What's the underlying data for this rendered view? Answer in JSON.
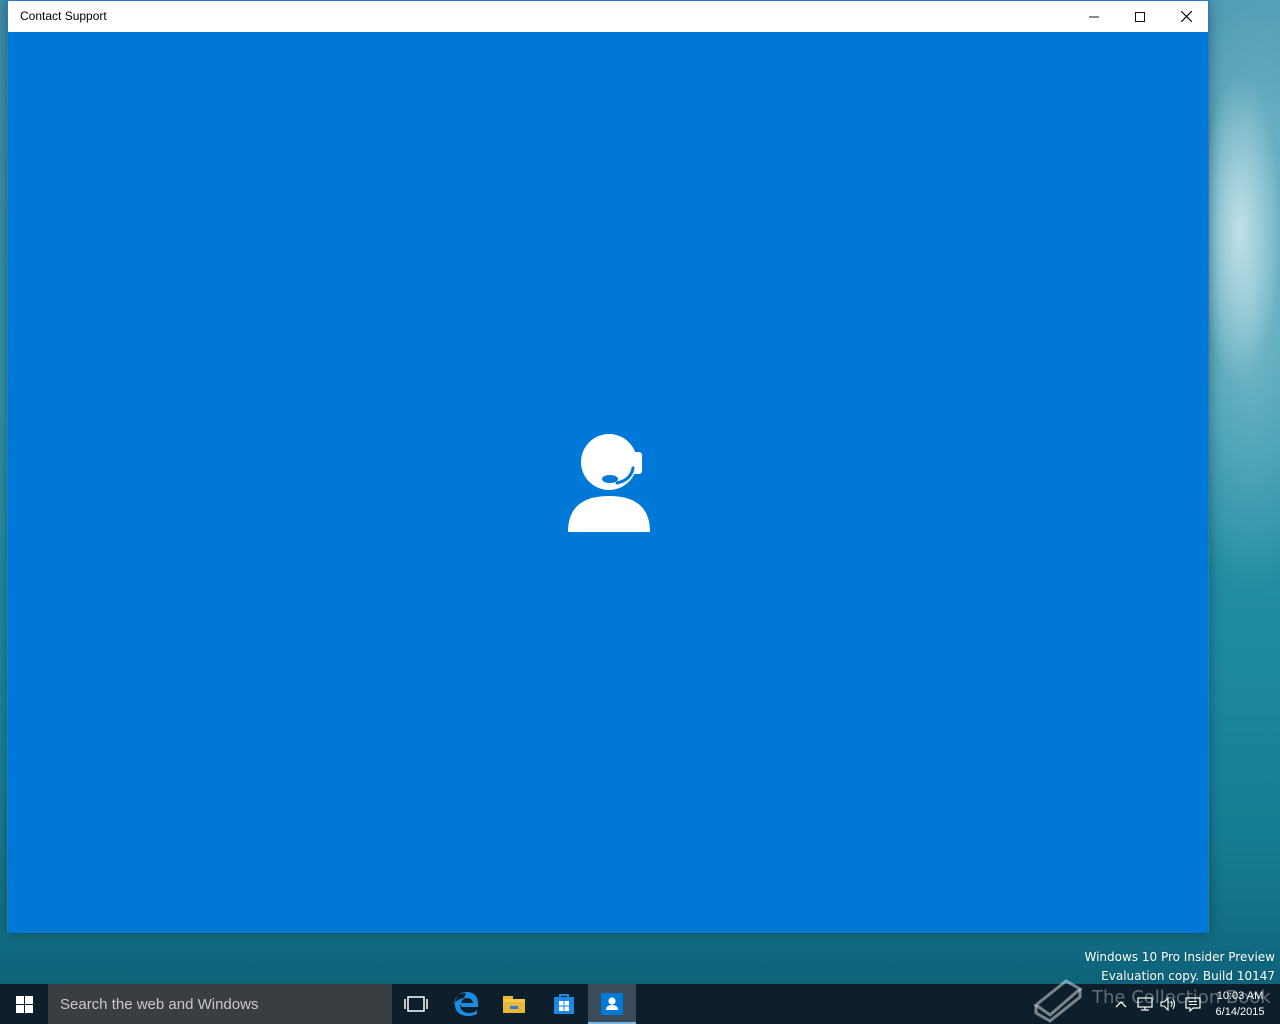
{
  "window": {
    "title": "Contact Support",
    "controls": {
      "minimize_icon": "minimize-icon",
      "maximize_icon": "maximize-icon",
      "close_icon": "close-icon"
    },
    "content_icon": "support-agent-icon",
    "accent_color": "#0078d7"
  },
  "watermark": {
    "line1": "Windows 10 Pro Insider Preview",
    "line2": "Evaluation copy. Build 10147",
    "site_logo_text": "The Collection Book"
  },
  "taskbar": {
    "search_placeholder": "Search the web and Windows",
    "apps": [
      "task-view-icon",
      "edge-icon",
      "file-explorer-icon",
      "store-icon",
      "contact-support-icon"
    ],
    "active_app": "contact-support-icon",
    "clock": {
      "time": "10:03 AM",
      "date": "6/14/2015"
    }
  }
}
